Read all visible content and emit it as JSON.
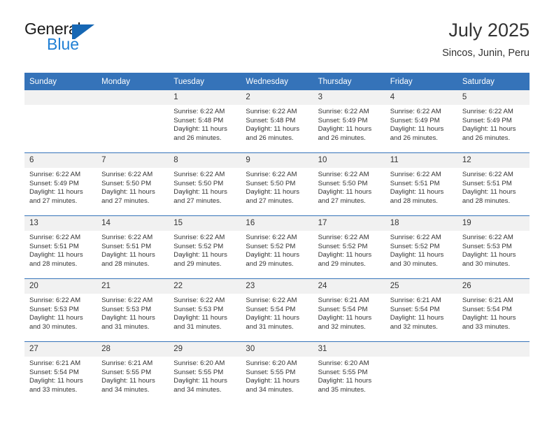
{
  "brand": {
    "name_top": "General",
    "name_bottom": "Blue",
    "mark": "triangle-logo"
  },
  "header": {
    "title": "July 2025",
    "subtitle": "Sincos, Junin, Peru"
  },
  "colors": {
    "header_blue": "#3573b9",
    "brand_blue": "#1f7fd4",
    "day_band": "#f1f1f1",
    "text": "#333333"
  },
  "weekday_headers": [
    "Sunday",
    "Monday",
    "Tuesday",
    "Wednesday",
    "Thursday",
    "Friday",
    "Saturday"
  ],
  "labels": {
    "sunrise_prefix": "Sunrise:",
    "sunset_prefix": "Sunset:",
    "daylight_prefix": "Daylight:"
  },
  "weeks": [
    [
      {
        "day": "",
        "empty": true,
        "sunrise": "",
        "sunset": "",
        "daylight_line1": "",
        "daylight_line2": ""
      },
      {
        "day": "",
        "empty": true,
        "sunrise": "",
        "sunset": "",
        "daylight_line1": "",
        "daylight_line2": ""
      },
      {
        "day": "1",
        "empty": false,
        "sunrise": "Sunrise: 6:22 AM",
        "sunset": "Sunset: 5:48 PM",
        "daylight_line1": "Daylight: 11 hours",
        "daylight_line2": "and 26 minutes."
      },
      {
        "day": "2",
        "empty": false,
        "sunrise": "Sunrise: 6:22 AM",
        "sunset": "Sunset: 5:48 PM",
        "daylight_line1": "Daylight: 11 hours",
        "daylight_line2": "and 26 minutes."
      },
      {
        "day": "3",
        "empty": false,
        "sunrise": "Sunrise: 6:22 AM",
        "sunset": "Sunset: 5:49 PM",
        "daylight_line1": "Daylight: 11 hours",
        "daylight_line2": "and 26 minutes."
      },
      {
        "day": "4",
        "empty": false,
        "sunrise": "Sunrise: 6:22 AM",
        "sunset": "Sunset: 5:49 PM",
        "daylight_line1": "Daylight: 11 hours",
        "daylight_line2": "and 26 minutes."
      },
      {
        "day": "5",
        "empty": false,
        "sunrise": "Sunrise: 6:22 AM",
        "sunset": "Sunset: 5:49 PM",
        "daylight_line1": "Daylight: 11 hours",
        "daylight_line2": "and 26 minutes."
      }
    ],
    [
      {
        "day": "6",
        "empty": false,
        "sunrise": "Sunrise: 6:22 AM",
        "sunset": "Sunset: 5:49 PM",
        "daylight_line1": "Daylight: 11 hours",
        "daylight_line2": "and 27 minutes."
      },
      {
        "day": "7",
        "empty": false,
        "sunrise": "Sunrise: 6:22 AM",
        "sunset": "Sunset: 5:50 PM",
        "daylight_line1": "Daylight: 11 hours",
        "daylight_line2": "and 27 minutes."
      },
      {
        "day": "8",
        "empty": false,
        "sunrise": "Sunrise: 6:22 AM",
        "sunset": "Sunset: 5:50 PM",
        "daylight_line1": "Daylight: 11 hours",
        "daylight_line2": "and 27 minutes."
      },
      {
        "day": "9",
        "empty": false,
        "sunrise": "Sunrise: 6:22 AM",
        "sunset": "Sunset: 5:50 PM",
        "daylight_line1": "Daylight: 11 hours",
        "daylight_line2": "and 27 minutes."
      },
      {
        "day": "10",
        "empty": false,
        "sunrise": "Sunrise: 6:22 AM",
        "sunset": "Sunset: 5:50 PM",
        "daylight_line1": "Daylight: 11 hours",
        "daylight_line2": "and 27 minutes."
      },
      {
        "day": "11",
        "empty": false,
        "sunrise": "Sunrise: 6:22 AM",
        "sunset": "Sunset: 5:51 PM",
        "daylight_line1": "Daylight: 11 hours",
        "daylight_line2": "and 28 minutes."
      },
      {
        "day": "12",
        "empty": false,
        "sunrise": "Sunrise: 6:22 AM",
        "sunset": "Sunset: 5:51 PM",
        "daylight_line1": "Daylight: 11 hours",
        "daylight_line2": "and 28 minutes."
      }
    ],
    [
      {
        "day": "13",
        "empty": false,
        "sunrise": "Sunrise: 6:22 AM",
        "sunset": "Sunset: 5:51 PM",
        "daylight_line1": "Daylight: 11 hours",
        "daylight_line2": "and 28 minutes."
      },
      {
        "day": "14",
        "empty": false,
        "sunrise": "Sunrise: 6:22 AM",
        "sunset": "Sunset: 5:51 PM",
        "daylight_line1": "Daylight: 11 hours",
        "daylight_line2": "and 28 minutes."
      },
      {
        "day": "15",
        "empty": false,
        "sunrise": "Sunrise: 6:22 AM",
        "sunset": "Sunset: 5:52 PM",
        "daylight_line1": "Daylight: 11 hours",
        "daylight_line2": "and 29 minutes."
      },
      {
        "day": "16",
        "empty": false,
        "sunrise": "Sunrise: 6:22 AM",
        "sunset": "Sunset: 5:52 PM",
        "daylight_line1": "Daylight: 11 hours",
        "daylight_line2": "and 29 minutes."
      },
      {
        "day": "17",
        "empty": false,
        "sunrise": "Sunrise: 6:22 AM",
        "sunset": "Sunset: 5:52 PM",
        "daylight_line1": "Daylight: 11 hours",
        "daylight_line2": "and 29 minutes."
      },
      {
        "day": "18",
        "empty": false,
        "sunrise": "Sunrise: 6:22 AM",
        "sunset": "Sunset: 5:52 PM",
        "daylight_line1": "Daylight: 11 hours",
        "daylight_line2": "and 30 minutes."
      },
      {
        "day": "19",
        "empty": false,
        "sunrise": "Sunrise: 6:22 AM",
        "sunset": "Sunset: 5:53 PM",
        "daylight_line1": "Daylight: 11 hours",
        "daylight_line2": "and 30 minutes."
      }
    ],
    [
      {
        "day": "20",
        "empty": false,
        "sunrise": "Sunrise: 6:22 AM",
        "sunset": "Sunset: 5:53 PM",
        "daylight_line1": "Daylight: 11 hours",
        "daylight_line2": "and 30 minutes."
      },
      {
        "day": "21",
        "empty": false,
        "sunrise": "Sunrise: 6:22 AM",
        "sunset": "Sunset: 5:53 PM",
        "daylight_line1": "Daylight: 11 hours",
        "daylight_line2": "and 31 minutes."
      },
      {
        "day": "22",
        "empty": false,
        "sunrise": "Sunrise: 6:22 AM",
        "sunset": "Sunset: 5:53 PM",
        "daylight_line1": "Daylight: 11 hours",
        "daylight_line2": "and 31 minutes."
      },
      {
        "day": "23",
        "empty": false,
        "sunrise": "Sunrise: 6:22 AM",
        "sunset": "Sunset: 5:54 PM",
        "daylight_line1": "Daylight: 11 hours",
        "daylight_line2": "and 31 minutes."
      },
      {
        "day": "24",
        "empty": false,
        "sunrise": "Sunrise: 6:21 AM",
        "sunset": "Sunset: 5:54 PM",
        "daylight_line1": "Daylight: 11 hours",
        "daylight_line2": "and 32 minutes."
      },
      {
        "day": "25",
        "empty": false,
        "sunrise": "Sunrise: 6:21 AM",
        "sunset": "Sunset: 5:54 PM",
        "daylight_line1": "Daylight: 11 hours",
        "daylight_line2": "and 32 minutes."
      },
      {
        "day": "26",
        "empty": false,
        "sunrise": "Sunrise: 6:21 AM",
        "sunset": "Sunset: 5:54 PM",
        "daylight_line1": "Daylight: 11 hours",
        "daylight_line2": "and 33 minutes."
      }
    ],
    [
      {
        "day": "27",
        "empty": false,
        "sunrise": "Sunrise: 6:21 AM",
        "sunset": "Sunset: 5:54 PM",
        "daylight_line1": "Daylight: 11 hours",
        "daylight_line2": "and 33 minutes."
      },
      {
        "day": "28",
        "empty": false,
        "sunrise": "Sunrise: 6:21 AM",
        "sunset": "Sunset: 5:55 PM",
        "daylight_line1": "Daylight: 11 hours",
        "daylight_line2": "and 34 minutes."
      },
      {
        "day": "29",
        "empty": false,
        "sunrise": "Sunrise: 6:20 AM",
        "sunset": "Sunset: 5:55 PM",
        "daylight_line1": "Daylight: 11 hours",
        "daylight_line2": "and 34 minutes."
      },
      {
        "day": "30",
        "empty": false,
        "sunrise": "Sunrise: 6:20 AM",
        "sunset": "Sunset: 5:55 PM",
        "daylight_line1": "Daylight: 11 hours",
        "daylight_line2": "and 34 minutes."
      },
      {
        "day": "31",
        "empty": false,
        "sunrise": "Sunrise: 6:20 AM",
        "sunset": "Sunset: 5:55 PM",
        "daylight_line1": "Daylight: 11 hours",
        "daylight_line2": "and 35 minutes."
      },
      {
        "day": "",
        "empty": true,
        "sunrise": "",
        "sunset": "",
        "daylight_line1": "",
        "daylight_line2": ""
      },
      {
        "day": "",
        "empty": true,
        "sunrise": "",
        "sunset": "",
        "daylight_line1": "",
        "daylight_line2": ""
      }
    ]
  ]
}
